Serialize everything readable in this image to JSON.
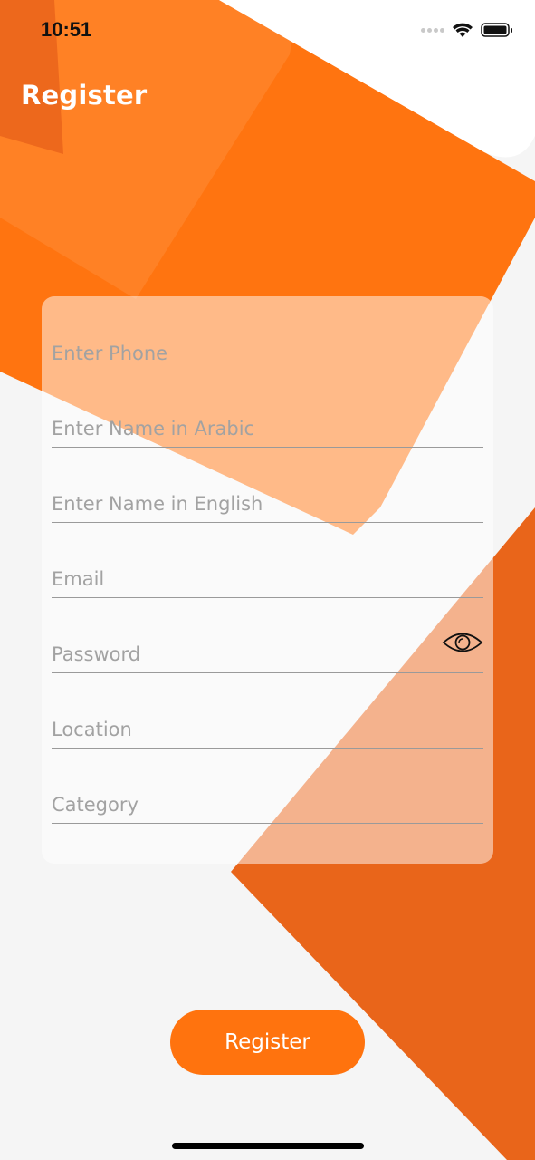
{
  "status_bar": {
    "time": "10:51",
    "icons": [
      "signal-dots-icon",
      "wifi-icon",
      "battery-icon"
    ]
  },
  "nav": {
    "title": "Register"
  },
  "form": {
    "phone_placeholder": "Enter Phone",
    "name_ar_placeholder": "Enter Name in Arabic",
    "name_en_placeholder": "Enter Name in English",
    "email_placeholder": "Email",
    "password_placeholder": "Password",
    "location_placeholder": "Location",
    "category_placeholder": "Category"
  },
  "register_button": {
    "label": "Register"
  },
  "colors": {
    "accent": "#ff730e",
    "accent_dark": "#e9661a",
    "background": "#f5f5f5"
  }
}
